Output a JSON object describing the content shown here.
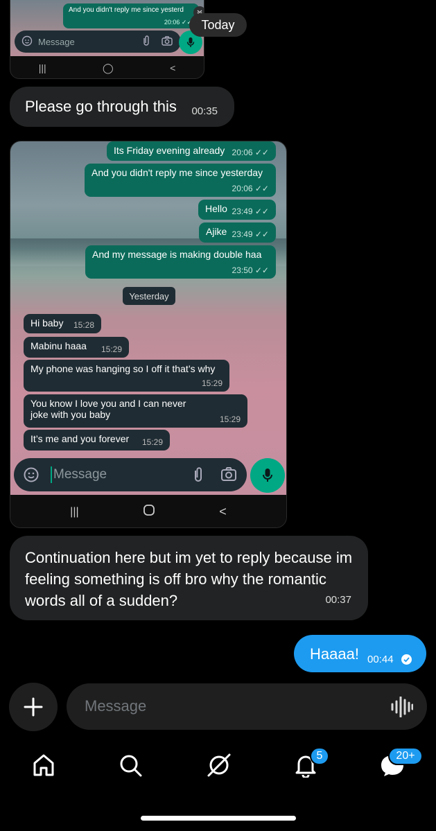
{
  "top_screenshot": {
    "outgoing_preview": "And you didn't reply me since yesterd",
    "outgoing_preview_time": "20:06 ✓✓",
    "message_placeholder": "Message",
    "nav_recent": "|||",
    "nav_home": "◯",
    "nav_back": "<"
  },
  "date_pill": "Today",
  "messages": [
    {
      "text": "Please go through this",
      "time": "00:35"
    }
  ],
  "screenshot": {
    "outgoing": [
      {
        "text": "Its Friday evening already",
        "time": "20:06"
      },
      {
        "text": "And you didn't reply me since yesterday",
        "time": "20:06"
      },
      {
        "text": "Hello",
        "time": "23:49"
      },
      {
        "text": "Ajike",
        "time": "23:49"
      },
      {
        "text": "And my message is making double haa",
        "time": "23:50"
      }
    ],
    "day_separator": "Yesterday",
    "incoming": [
      {
        "text": "Hi baby",
        "time": "15:28"
      },
      {
        "text": "Mabinu haaa",
        "time": "15:29"
      },
      {
        "text": "My phone was hanging so I off it that’s why",
        "time": "15:29"
      },
      {
        "text": "You know I love you and I can never joke with you baby",
        "time": "15:29"
      },
      {
        "text": "It’s me and you forever",
        "time": "15:29"
      }
    ],
    "message_placeholder": "Message",
    "nav_recent": "|||",
    "nav_back": "<"
  },
  "message2": {
    "text": "Continuation here but im yet to reply because im feeling something is off bro why the romantic words all of a sudden?",
    "time": "00:37"
  },
  "outgoing_reply": {
    "text": "Haaaa!",
    "time": "00:44"
  },
  "composer": {
    "placeholder": "Message"
  },
  "tabbar": {
    "notifications_badge": "5",
    "messages_badge": "20+"
  },
  "colors": {
    "accent": "#1d9bf0",
    "whatsapp_green": "#00a884",
    "whatsapp_bubble_out": "#0b6b5a",
    "whatsapp_bubble_in": "#1f2c33",
    "dm_bubble_in": "#222324"
  }
}
